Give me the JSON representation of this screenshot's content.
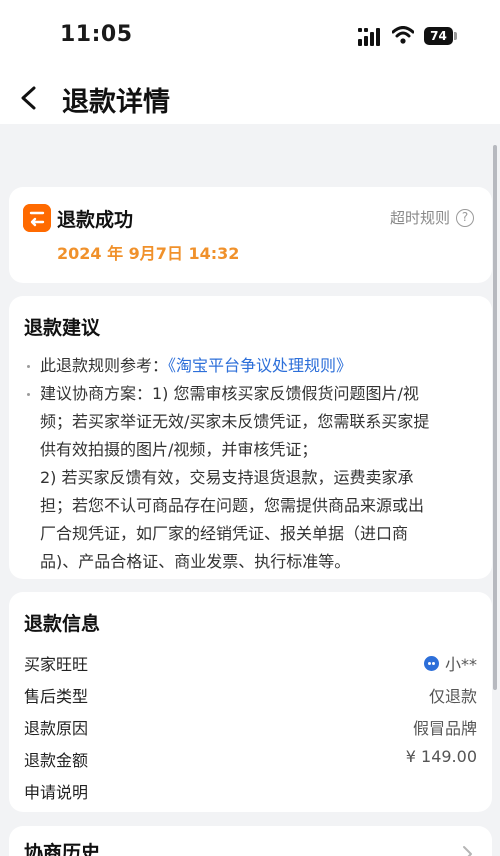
{
  "status_bar": {
    "time": "11:05",
    "battery": "74"
  },
  "nav": {
    "title": "退款详情"
  },
  "refund_status": {
    "title": "退款成功",
    "timeout_rule_label": "超时规则",
    "date": "2024 年 9月7日 14:32",
    "accent_color": "#ff6a00",
    "date_color": "#f0912b"
  },
  "advice": {
    "title": "退款建议",
    "rule_prefix": "此退款规则参考：",
    "rule_link": "《淘宝平台争议处理规则》",
    "line1": "建议协商方案：1) 您需审核买家反馈假货问题图片/视",
    "line2": "频；若买家举证无效/买家未反馈凭证，您需联系买家提",
    "line3": "供有效拍摄的图片/视频，并审核凭证；",
    "line4": "2) 若买家反馈有效，交易支持退货退款，运费卖家承",
    "line5": "担；若您不认可商品存在问题，您需提供商品来源或出",
    "line6": "厂合规凭证，如厂家的经销凭证、报关单据（进口商",
    "line7": "品)、产品合格证、商业发票、执行标准等。",
    "link_color": "#2d6fd9"
  },
  "info": {
    "title": "退款信息",
    "rows": [
      {
        "label": "买家旺旺",
        "value": "小**"
      },
      {
        "label": "售后类型",
        "value": "仅退款"
      },
      {
        "label": "退款原因",
        "value": "假冒品牌"
      },
      {
        "label": "退款金额",
        "value": "¥ 149.00"
      },
      {
        "label": "申请说明",
        "value": ""
      }
    ]
  },
  "history": {
    "title": "协商历史"
  }
}
